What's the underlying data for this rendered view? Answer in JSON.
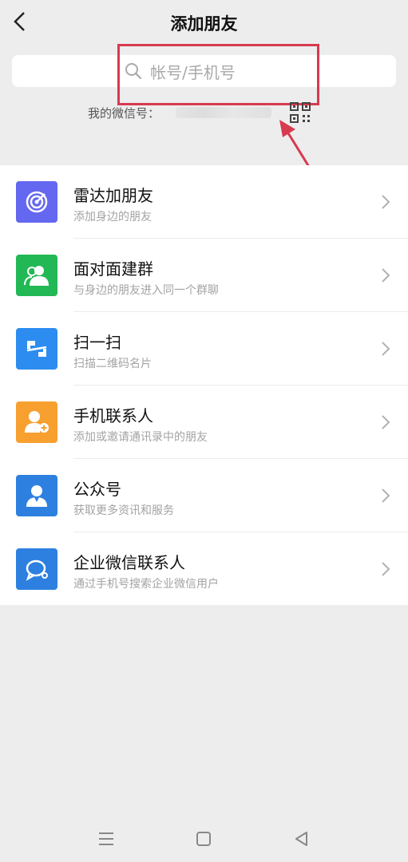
{
  "header": {
    "title": "添加朋友",
    "back_icon": "back-arrow-icon"
  },
  "search": {
    "placeholder": "帐号/手机号",
    "icon": "search-icon"
  },
  "my_id": {
    "label": "我的微信号：",
    "qr_icon": "qr-code-icon"
  },
  "annotation": {
    "color": "#d73a4f"
  },
  "menu": {
    "items": [
      {
        "title": "雷达加朋友",
        "subtitle": "添加身边的朋友",
        "icon": "radar-icon",
        "color": "#6467ef"
      },
      {
        "title": "面对面建群",
        "subtitle": "与身边的朋友进入同一个群聊",
        "icon": "group-icon",
        "color": "#22b855"
      },
      {
        "title": "扫一扫",
        "subtitle": "扫描二维码名片",
        "icon": "scan-icon",
        "color": "#2d8cf0"
      },
      {
        "title": "手机联系人",
        "subtitle": "添加或邀请通讯录中的朋友",
        "icon": "add-contact-icon",
        "color": "#f7a030"
      },
      {
        "title": "公众号",
        "subtitle": "获取更多资讯和服务",
        "icon": "official-account-icon",
        "color": "#2d80e0"
      },
      {
        "title": "企业微信联系人",
        "subtitle": "通过手机号搜索企业微信用户",
        "icon": "work-wechat-icon",
        "color": "#2d80e0"
      }
    ]
  },
  "navbar": {
    "menu_icon": "menu-icon",
    "home_icon": "home-icon",
    "back_icon": "back-triangle-icon"
  }
}
